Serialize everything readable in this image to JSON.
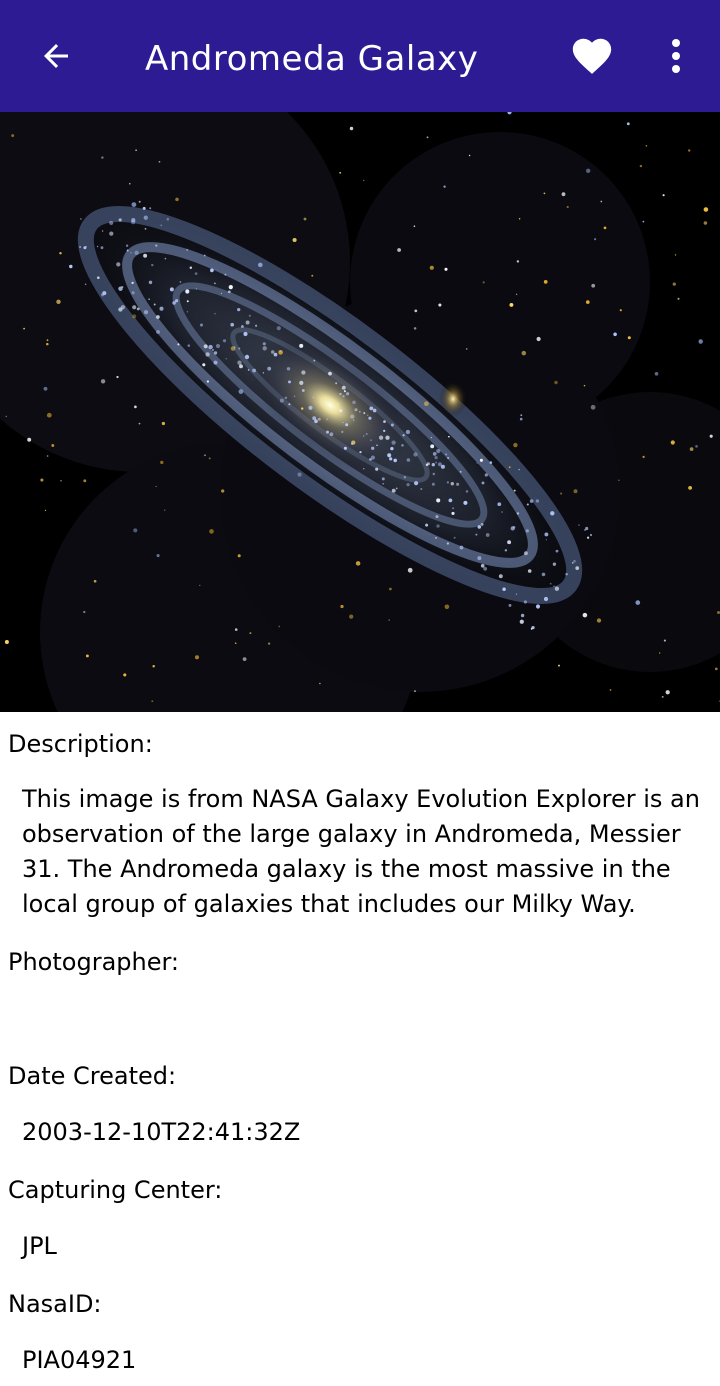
{
  "header": {
    "title": "Andromeda Galaxy",
    "back_icon": "arrow-left-icon",
    "favorite_icon": "heart-icon",
    "menu_icon": "more-vert-icon",
    "background_color": "#2d1b94"
  },
  "photo": {
    "alt": "Andromeda Galaxy"
  },
  "details": {
    "description_label": "Description:",
    "description_value": "This image is from NASA Galaxy Evolution Explorer is an observation of the large galaxy in Andromeda, Messier 31. The Andromeda galaxy is the most massive in the local group of galaxies that includes our Milky Way.",
    "photographer_label": "Photographer:",
    "photographer_value": "",
    "date_label": "Date Created:",
    "date_value": "2003-12-10T22:41:32Z",
    "center_label": "Capturing Center:",
    "center_value": "JPL",
    "nasa_id_label": "NasaID:",
    "nasa_id_value": "PIA04921"
  }
}
